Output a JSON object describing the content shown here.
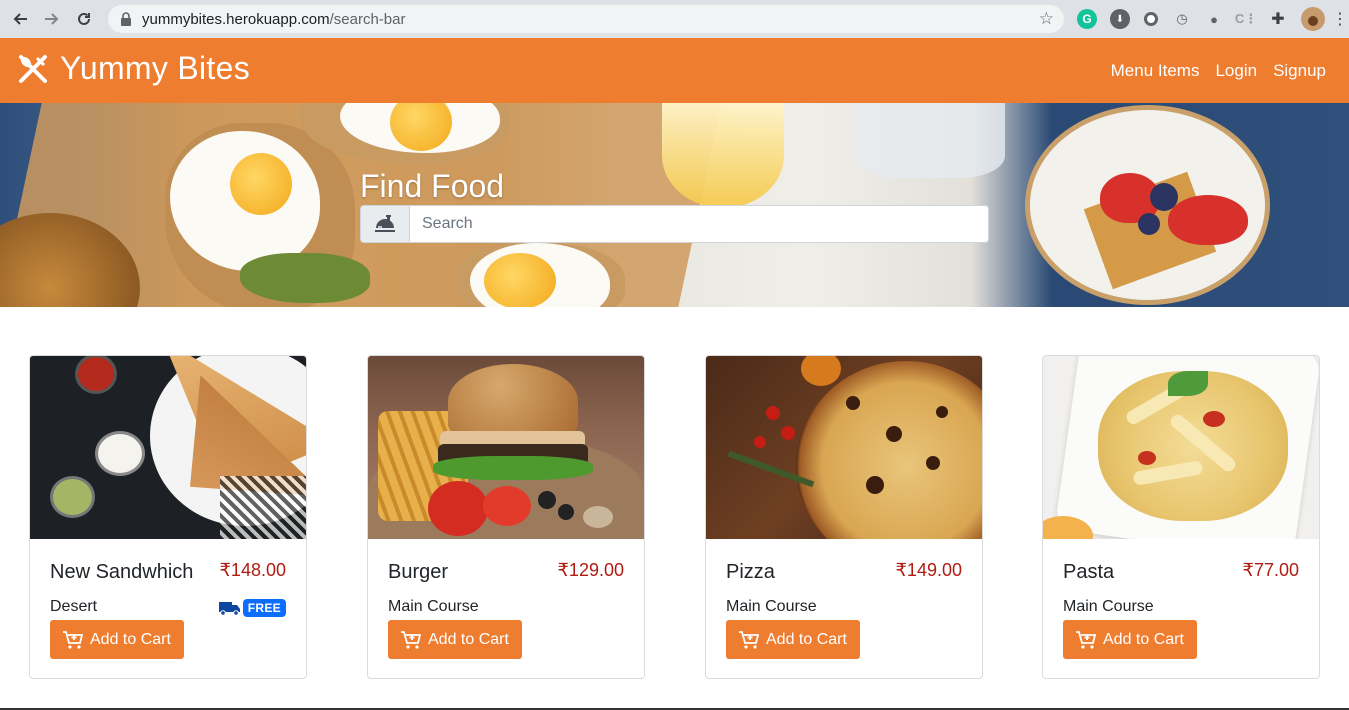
{
  "browser": {
    "url_host": "yummybites.herokuapp.com",
    "url_path": "/search-bar"
  },
  "navbar": {
    "brand": "Yummy Bites",
    "links": [
      "Menu Items",
      "Login",
      "Signup"
    ]
  },
  "hero": {
    "title": "Find Food",
    "search_placeholder": "Search"
  },
  "cards": [
    {
      "title": "New Sandwhich",
      "price": "₹148.00",
      "category": "Desert",
      "free_delivery": true,
      "badge": "FREE",
      "button": "Add to Cart"
    },
    {
      "title": "Burger",
      "price": "₹129.00",
      "category": "Main Course",
      "free_delivery": false,
      "button": "Add to Cart"
    },
    {
      "title": "Pizza",
      "price": "₹149.00",
      "category": "Main Course",
      "free_delivery": false,
      "button": "Add to Cart"
    },
    {
      "title": "Pasta",
      "price": "₹77.00",
      "category": "Main Course",
      "free_delivery": false,
      "button": "Add to Cart"
    }
  ],
  "colors": {
    "brand_orange": "#ef7d30",
    "price_red": "#b01c12",
    "badge_blue": "#0d6efd"
  }
}
